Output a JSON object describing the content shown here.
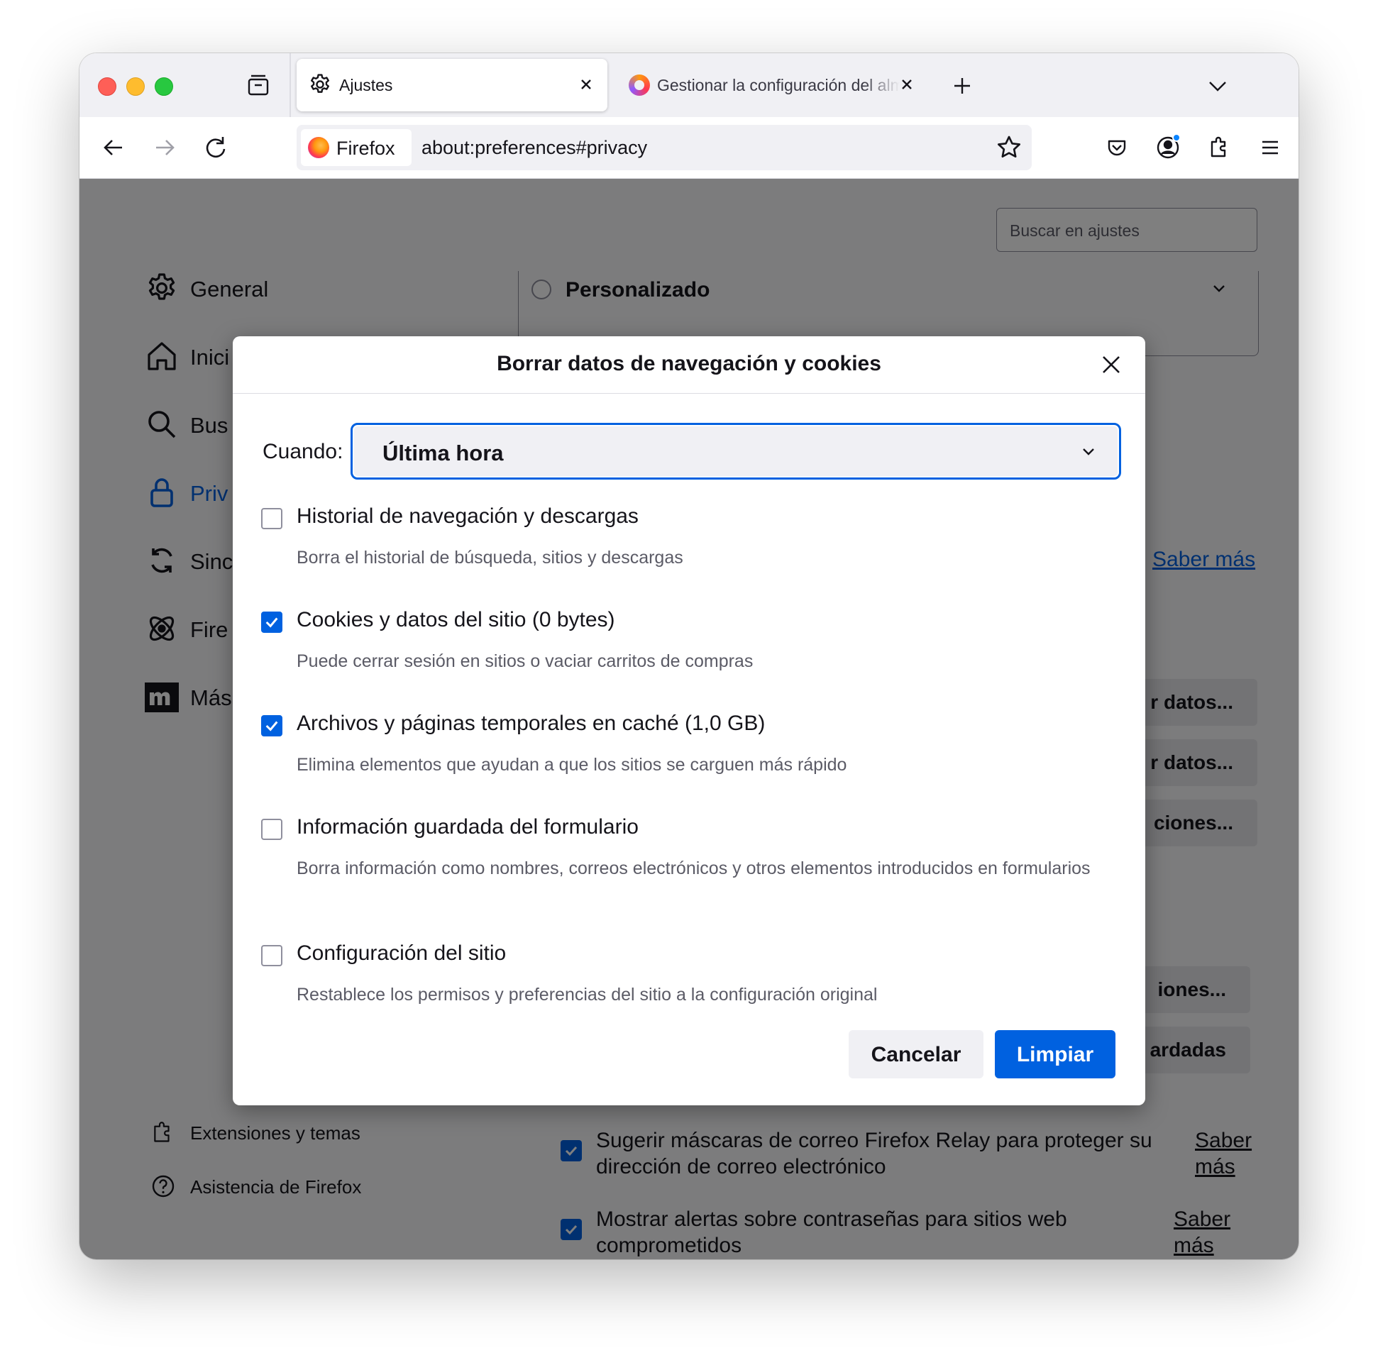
{
  "tabs": [
    {
      "label": "Ajustes",
      "icon": "gear-icon",
      "active": true
    },
    {
      "label": "Gestionar la configuración del almacenamiento",
      "icon": "firefox-icon",
      "active": false
    }
  ],
  "navbar": {
    "identity_label": "Firefox",
    "url": "about:preferences#privacy"
  },
  "search": {
    "placeholder": "Buscar en ajustes"
  },
  "sidebar": {
    "items": [
      {
        "label": "General",
        "icon": "gear-icon"
      },
      {
        "label": "Inici",
        "icon": "home-icon"
      },
      {
        "label": "Bus",
        "icon": "search-icon"
      },
      {
        "label": "Priv",
        "icon": "lock-icon",
        "selected": true
      },
      {
        "label": "Sinc",
        "icon": "sync-icon"
      },
      {
        "label": "Fire",
        "icon": "firefox-labs-icon"
      },
      {
        "label": "Más",
        "icon": "mozilla-m-icon"
      }
    ],
    "footer": [
      {
        "label": "Extensiones y temas",
        "icon": "puzzle-icon"
      },
      {
        "label": "Asistencia de Firefox",
        "icon": "help-icon"
      }
    ]
  },
  "background": {
    "section_title": "Personalizado",
    "learn_more_1": "Saber más",
    "buttons": [
      "r datos...",
      "r datos...",
      "ciones...",
      "iones...",
      "ardadas"
    ],
    "relay_text": "Sugerir máscaras de correo Firefox Relay para proteger su dirección de correo electrónico",
    "relay_link": "Saber más",
    "alerts_text": "Mostrar alertas sobre contraseñas para sitios web comprometidos",
    "alerts_link": "Saber más"
  },
  "dialog": {
    "title": "Borrar datos de navegación y cookies",
    "when_label": "Cuando:",
    "when_value": "Última hora",
    "options": [
      {
        "label": "Historial de navegación y descargas",
        "desc": "Borra el historial de búsqueda, sitios y descargas",
        "checked": false
      },
      {
        "label": "Cookies y datos del sitio (0 bytes)",
        "desc": "Puede cerrar sesión en sitios o vaciar carritos de compras",
        "checked": true
      },
      {
        "label": "Archivos y páginas temporales en caché (1,0 GB)",
        "desc": "Elimina elementos que ayudan a que los sitios se carguen más rápido",
        "checked": true
      },
      {
        "label": "Información guardada del formulario",
        "desc": "Borra información como nombres, correos electrónicos y otros elementos introducidos en formularios",
        "checked": false
      },
      {
        "label": "Configuración del sitio",
        "desc": "Restablece los permisos y preferencias del sitio a la configuración original",
        "checked": false
      }
    ],
    "cancel_label": "Cancelar",
    "clear_label": "Limpiar"
  },
  "colors": {
    "accent": "#0061e0",
    "overlay": "rgba(0,0,0,0.5)"
  }
}
